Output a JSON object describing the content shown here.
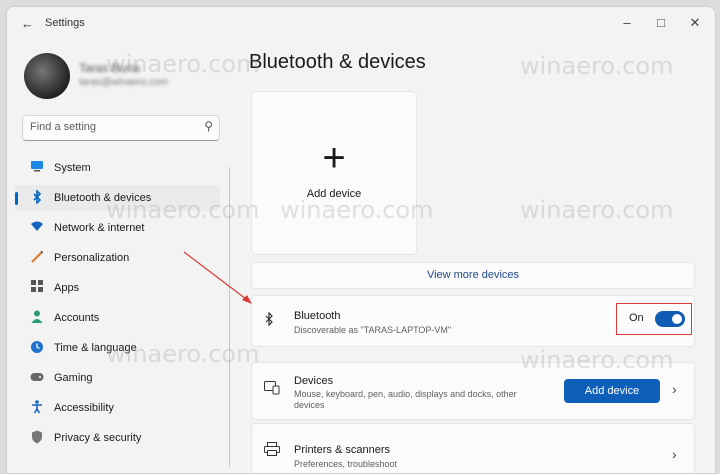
{
  "window": {
    "title": "Settings",
    "back_icon": "back-arrow-icon",
    "controls": [
      "minimize",
      "maximize",
      "close"
    ]
  },
  "user": {
    "name": "Taras Buria",
    "email": "taras@winaero.com"
  },
  "search": {
    "placeholder": "Find a setting"
  },
  "sidebar": {
    "items": [
      {
        "label": "System",
        "icon": "monitor-icon",
        "color": "#1e88e5"
      },
      {
        "label": "Bluetooth & devices",
        "icon": "bluetooth-icon",
        "color": "#0067c0",
        "selected": true
      },
      {
        "label": "Network & internet",
        "icon": "wifi-icon",
        "color": "#1565c0"
      },
      {
        "label": "Personalization",
        "icon": "pen-icon",
        "color": "#e07a2c"
      },
      {
        "label": "Apps",
        "icon": "apps-icon",
        "color": "#555555"
      },
      {
        "label": "Accounts",
        "icon": "person-icon",
        "color": "#2a9d6f"
      },
      {
        "label": "Time & language",
        "icon": "globe-clock-icon",
        "color": "#1f72c9"
      },
      {
        "label": "Gaming",
        "icon": "gamepad-icon",
        "color": "#555555"
      },
      {
        "label": "Accessibility",
        "icon": "accessibility-icon",
        "color": "#1565c0"
      },
      {
        "label": "Privacy & security",
        "icon": "shield-icon",
        "color": "#666666"
      }
    ]
  },
  "main": {
    "title": "Bluetooth & devices",
    "add_tile_label": "Add device",
    "view_more": "View more devices",
    "bluetooth": {
      "title": "Bluetooth",
      "subtitle": "Discoverable as \"TARAS-LAPTOP-VM\"",
      "state_label": "On",
      "enabled": true
    },
    "devices": {
      "title": "Devices",
      "subtitle": "Mouse, keyboard, pen, audio, displays and docks, other devices",
      "button": "Add device"
    },
    "printers": {
      "title": "Printers & scanners",
      "subtitle": "Preferences, troubleshoot"
    }
  },
  "watermark": "winaero.com",
  "colors": {
    "accent": "#0067c0",
    "annotation": "#d93a3a"
  }
}
